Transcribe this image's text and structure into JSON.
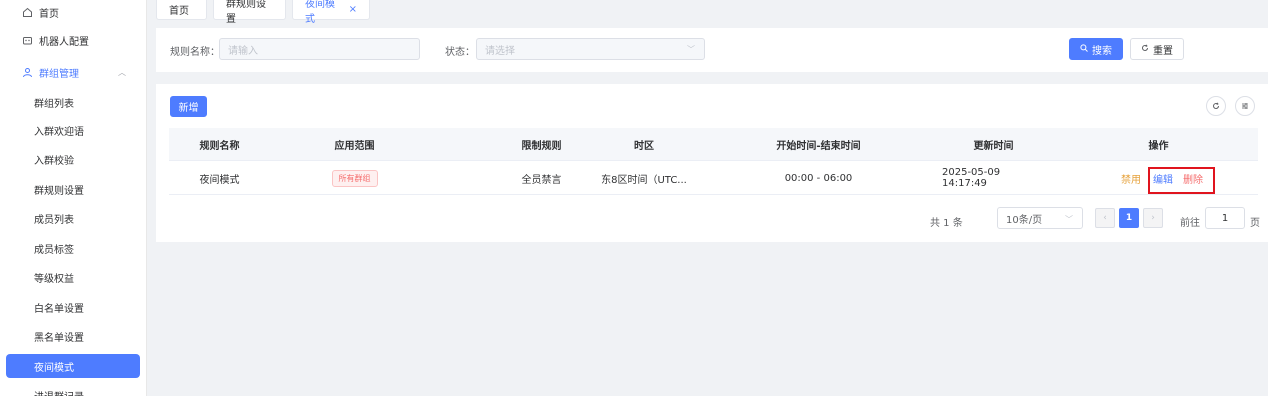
{
  "sidebar": {
    "home": "首页",
    "robot_config": "机器人配置",
    "group_mgmt": "群组管理",
    "items": [
      {
        "label": "群组列表"
      },
      {
        "label": "入群欢迎语"
      },
      {
        "label": "入群校验"
      },
      {
        "label": "群规则设置"
      },
      {
        "label": "成员列表"
      },
      {
        "label": "成员标签"
      },
      {
        "label": "等级权益"
      },
      {
        "label": "白名单设置"
      },
      {
        "label": "黑名单设置"
      },
      {
        "label": "夜间模式"
      },
      {
        "label": "进退群记录"
      }
    ]
  },
  "tabs": [
    {
      "label": "首页"
    },
    {
      "label": "群规则设置"
    },
    {
      "label": "夜间模式"
    }
  ],
  "search": {
    "name_label": "规则名称",
    "name_placeholder": "请输入",
    "status_label": "状态",
    "status_placeholder": "请选择",
    "search_btn": "搜索",
    "reset_btn": "重置"
  },
  "toolbar": {
    "add_btn": "新增"
  },
  "table": {
    "headers": [
      "规则名称",
      "应用范围",
      "限制规则",
      "时区",
      "开始时间-结束时间",
      "更新时间",
      "操作"
    ],
    "rows": [
      {
        "name": "夜间模式",
        "scope": "所有群组",
        "rule": "全员禁言",
        "timezone": "东8区时间（UTC...",
        "time_range": "00:00 - 06:00",
        "updated": "2025-05-09 14:17:49",
        "op_disable": "禁用",
        "op_edit": "编辑",
        "op_delete": "删除"
      }
    ]
  },
  "pagination": {
    "total": "共 1 条",
    "page_size": "10条/页",
    "current": "1",
    "goto_label": "前往",
    "goto_value": "1",
    "page_unit": "页"
  },
  "colors": {
    "primary": "#4e7cff",
    "danger": "#f56c6c",
    "warning": "#e6a23c",
    "highlight": "#e0141e"
  }
}
